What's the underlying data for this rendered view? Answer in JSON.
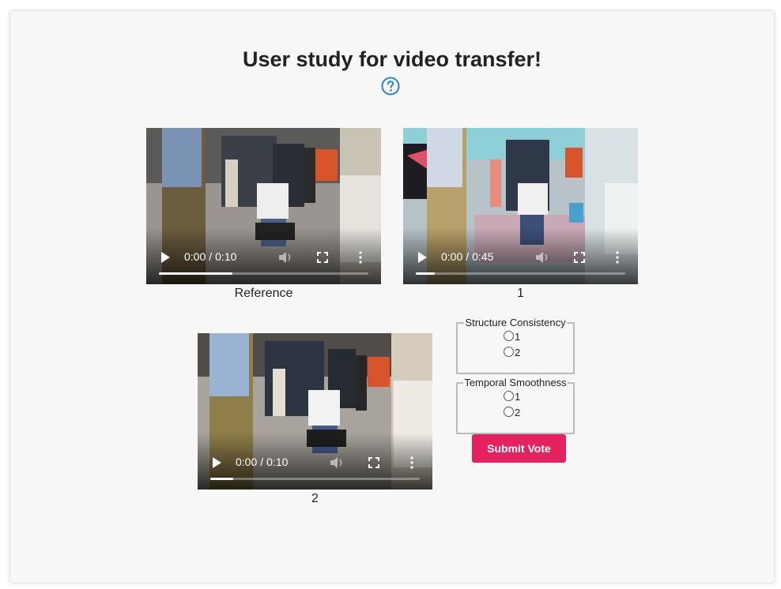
{
  "page": {
    "title": "User study for video transfer!",
    "help_icon": "question-circle-icon"
  },
  "videos": [
    {
      "time_current": "0:00",
      "time_total": "0:10",
      "progress": 0.35,
      "caption": "Reference"
    },
    {
      "time_current": "0:00",
      "time_total": "0:45",
      "progress": 0.09,
      "caption": "1"
    },
    {
      "time_current": "0:00",
      "time_total": "0:10",
      "progress": 0.11,
      "caption": "2"
    }
  ],
  "questions": [
    {
      "legend": "Structure Consistency",
      "options": [
        "1",
        "2"
      ]
    },
    {
      "legend": "Temporal Smoothness",
      "options": [
        "1",
        "2"
      ]
    }
  ],
  "submit_label": "Submit Vote",
  "colors": {
    "accent": "#e3225f",
    "help": "#2a7fd4",
    "card_bg": "#f7f7f7"
  }
}
